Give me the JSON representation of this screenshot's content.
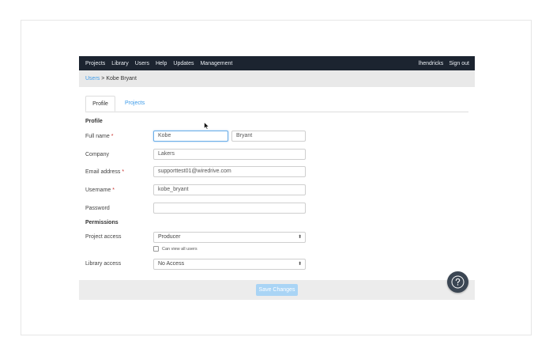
{
  "nav": {
    "left": [
      "Projects",
      "Library",
      "Users",
      "Help",
      "Updates",
      "Management"
    ],
    "user": "lhendricks",
    "signout": "Sign out"
  },
  "breadcrumb": {
    "link": "Users",
    "separator": ">",
    "current": "Kobe Bryant"
  },
  "tabs": {
    "profile": "Profile",
    "projects": "Projects"
  },
  "sections": {
    "profile": "Profile",
    "permissions": "Permissions"
  },
  "fields": {
    "fullname_label": "Full name",
    "first_name": "Kobe",
    "last_name": "Bryant",
    "company_label": "Company",
    "company": "Lakers",
    "email_label": "Email address",
    "email": "supporttest01@wiredrive.com",
    "username_label": "Username",
    "username": "kobe_bryant",
    "password_label": "Password",
    "password": "",
    "required_mark": "*"
  },
  "permissions": {
    "project_access_label": "Project access",
    "project_access_value": "Producer",
    "can_view_all_users": "Can view all users",
    "library_access_label": "Library access",
    "library_access_value": "No Access"
  },
  "footer": {
    "save": "Save Changes"
  },
  "colors": {
    "nav_bg": "#1c2430",
    "link": "#3d9be9",
    "save_btn": "#a9d4f5",
    "required": "#c9302c",
    "help_btn": "#3b4653"
  },
  "icons": {
    "help": "question-circle-icon",
    "cursor": "mouse-cursor-icon",
    "select_arrows": "up-down-arrows-icon"
  }
}
